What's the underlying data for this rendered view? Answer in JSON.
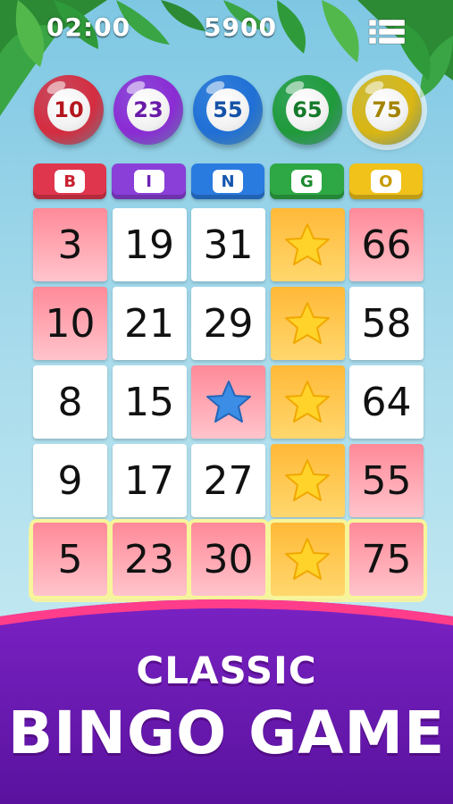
{
  "hud": {
    "timer": "02:00",
    "score": "5900"
  },
  "called_balls": [
    {
      "number": "10",
      "color": "#d52c3f",
      "text_color": "#b5161f"
    },
    {
      "number": "23",
      "color": "#8b2bd4",
      "text_color": "#6a1aa8"
    },
    {
      "number": "55",
      "color": "#1f6fd6",
      "text_color": "#1552a8"
    },
    {
      "number": "65",
      "color": "#1f9a3a",
      "text_color": "#157a2a"
    },
    {
      "number": "75",
      "color": "#d9b613",
      "text_color": "#a38400"
    }
  ],
  "headers": [
    {
      "letter": "B",
      "color": "#e0364d",
      "text_color": "#c8202f"
    },
    {
      "letter": "I",
      "color": "#8a3fd8",
      "text_color": "#6d22b5"
    },
    {
      "letter": "N",
      "color": "#2a7be0",
      "text_color": "#1656b0"
    },
    {
      "letter": "G",
      "color": "#2ea844",
      "text_color": "#1b8a2e"
    },
    {
      "letter": "O",
      "color": "#f0c21a",
      "text_color": "#c79a00"
    }
  ],
  "grid": [
    [
      {
        "value": "3",
        "state": "marked"
      },
      {
        "value": "19",
        "state": "open"
      },
      {
        "value": "31",
        "state": "open"
      },
      {
        "value": "",
        "state": "star-yellow"
      },
      {
        "value": "66",
        "state": "marked"
      }
    ],
    [
      {
        "value": "10",
        "state": "marked"
      },
      {
        "value": "21",
        "state": "open"
      },
      {
        "value": "29",
        "state": "open"
      },
      {
        "value": "",
        "state": "star-yellow"
      },
      {
        "value": "58",
        "state": "open"
      }
    ],
    [
      {
        "value": "8",
        "state": "open"
      },
      {
        "value": "15",
        "state": "open"
      },
      {
        "value": "",
        "state": "free"
      },
      {
        "value": "",
        "state": "star-yellow"
      },
      {
        "value": "64",
        "state": "open"
      }
    ],
    [
      {
        "value": "9",
        "state": "open"
      },
      {
        "value": "17",
        "state": "open"
      },
      {
        "value": "27",
        "state": "open"
      },
      {
        "value": "",
        "state": "star-yellow"
      },
      {
        "value": "55",
        "state": "marked"
      }
    ],
    [
      {
        "value": "5",
        "state": "marked-win"
      },
      {
        "value": "23",
        "state": "marked-win"
      },
      {
        "value": "30",
        "state": "marked-win"
      },
      {
        "value": "",
        "state": "star-yellow-win"
      },
      {
        "value": "75",
        "state": "marked-win"
      }
    ]
  ],
  "banner": {
    "line1": "CLASSIC",
    "line2": "BINGO GAME"
  },
  "icons": {
    "menu": "list-menu-icon",
    "star": "star-icon",
    "free": "blue-star-icon"
  },
  "colors": {
    "banner": "#6a1bb0",
    "banner_edge": "#ff3d8a",
    "star_yellow": "#ffd32a",
    "free_star": "#3c8de6"
  }
}
